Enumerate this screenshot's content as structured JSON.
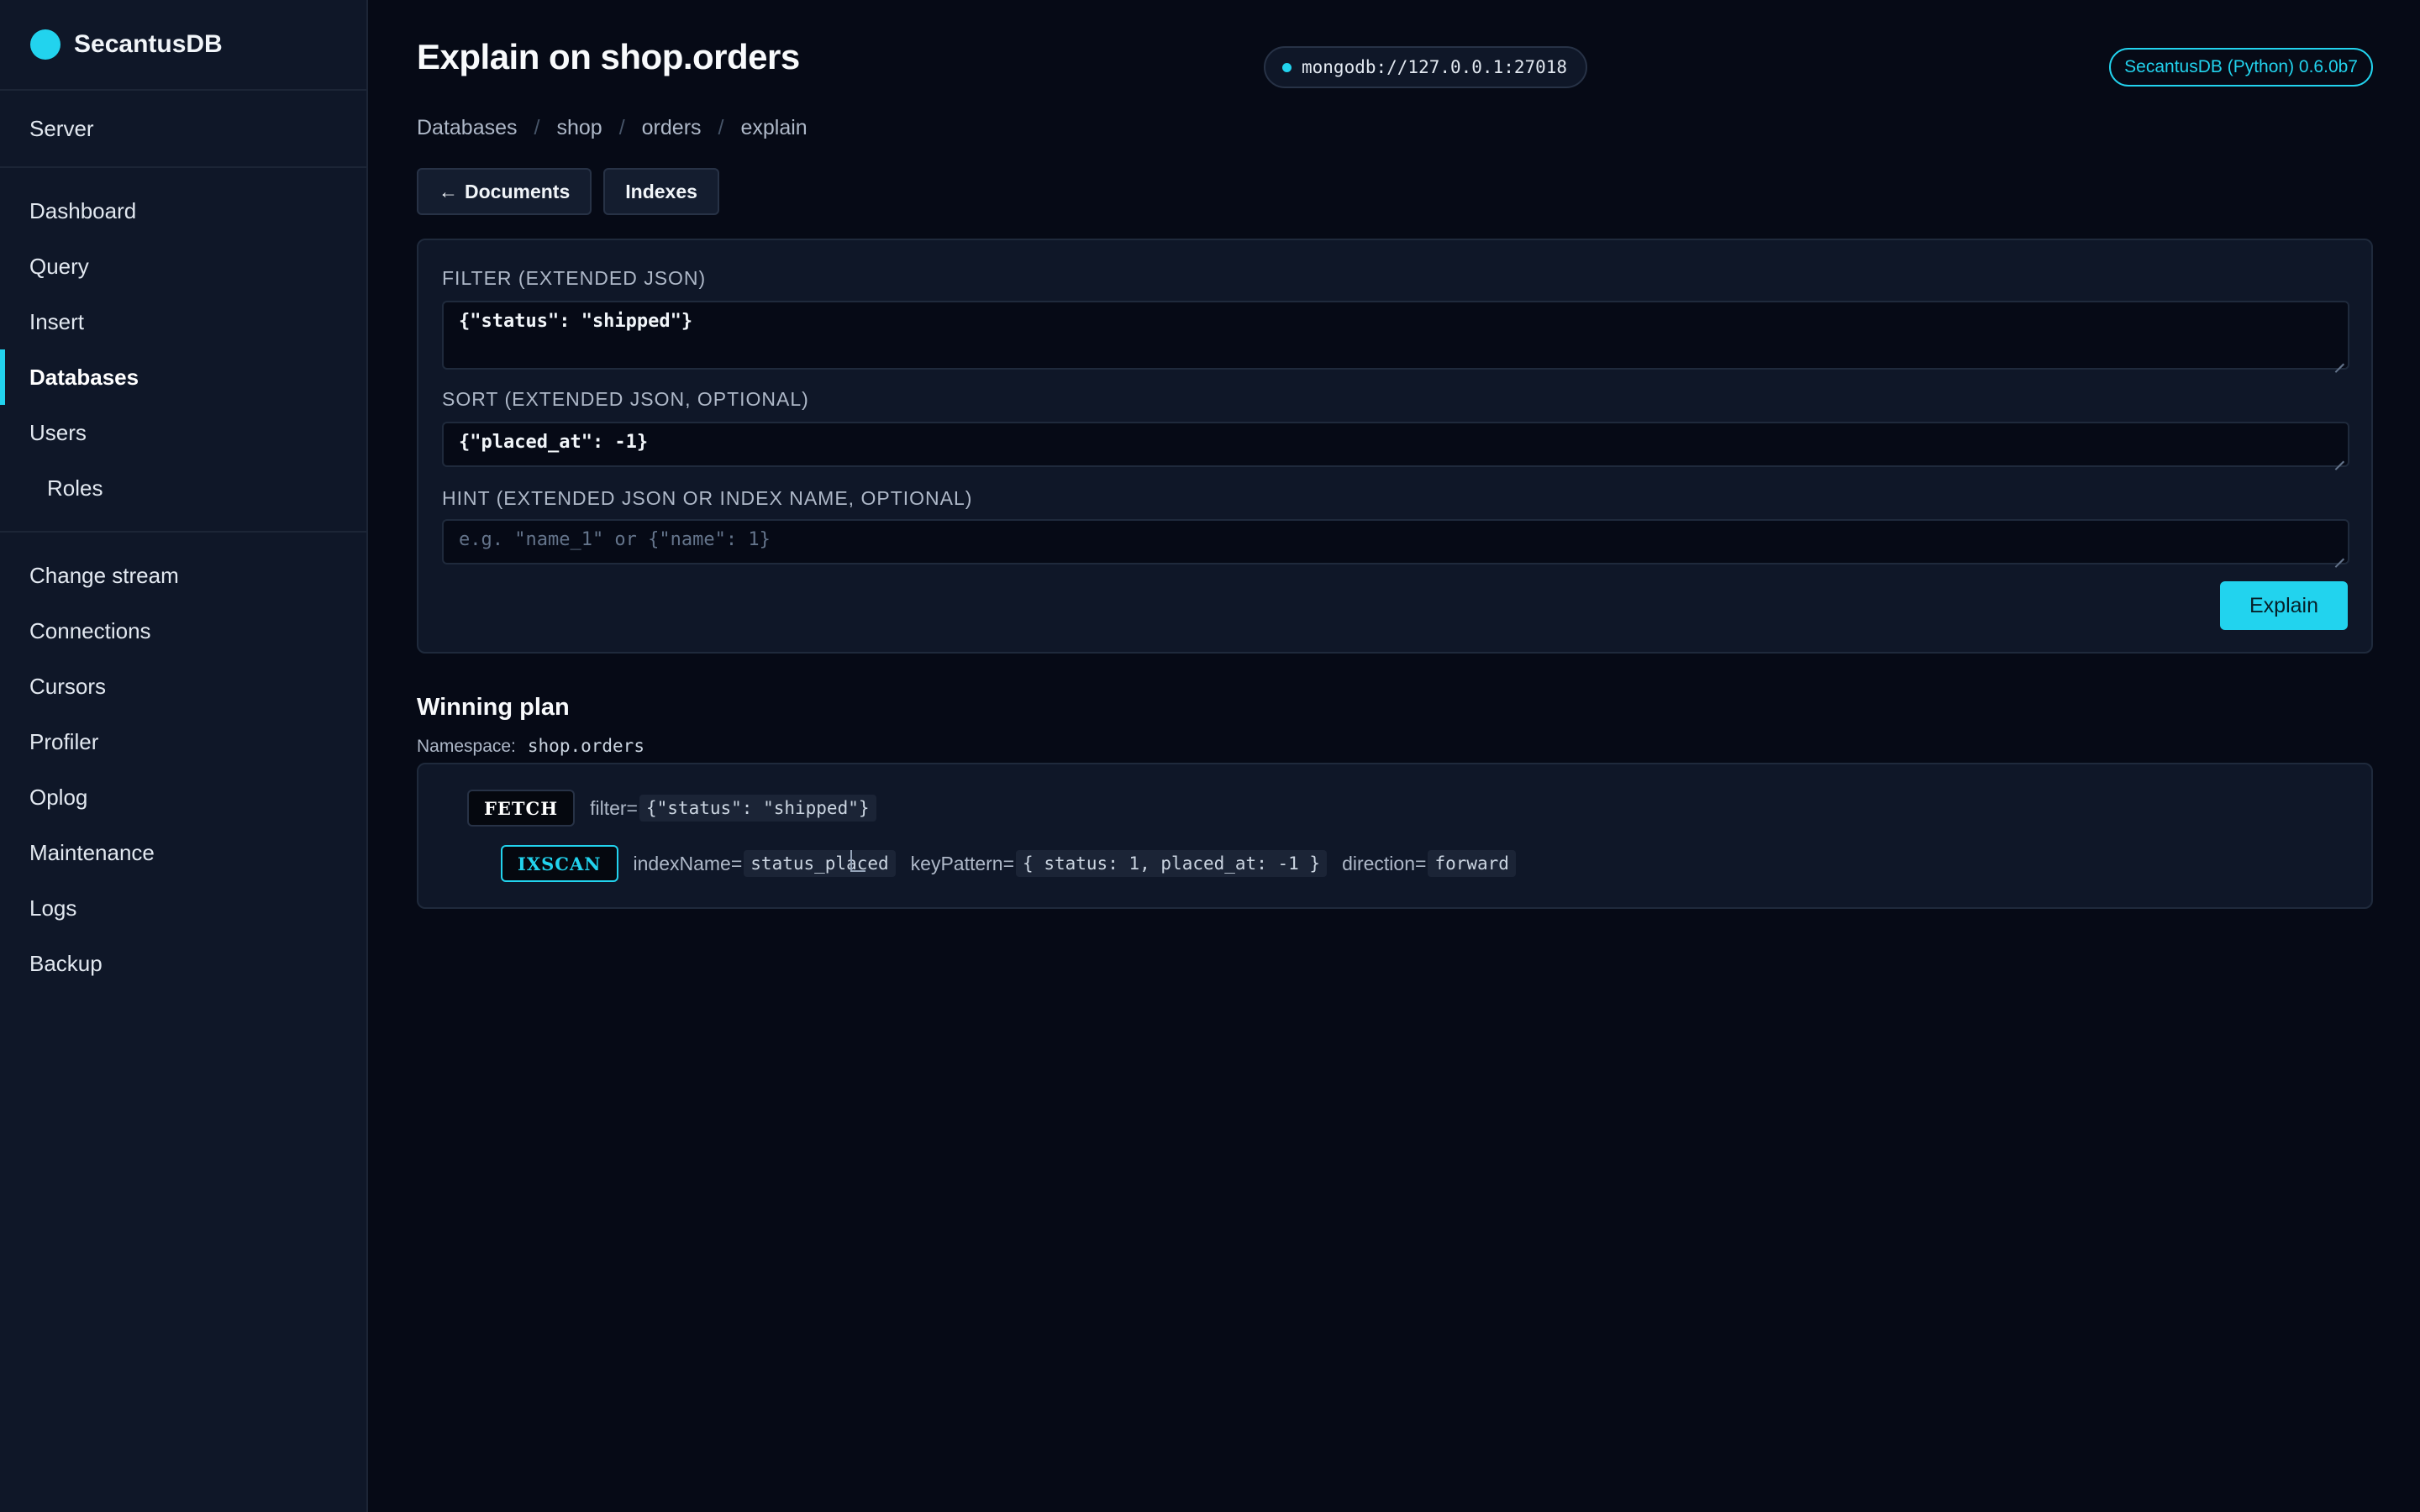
{
  "brand": {
    "name": "SecantusDB",
    "accent": "#22d3ee"
  },
  "sidebar": {
    "groups": [
      [
        {
          "label": "Server"
        }
      ],
      [
        {
          "label": "Dashboard"
        },
        {
          "label": "Query"
        },
        {
          "label": "Insert"
        },
        {
          "label": "Databases",
          "active": true
        },
        {
          "label": "Users"
        },
        {
          "label": "Roles",
          "sub": true
        }
      ],
      [
        {
          "label": "Change stream"
        },
        {
          "label": "Connections"
        },
        {
          "label": "Cursors"
        },
        {
          "label": "Profiler"
        },
        {
          "label": "Oplog"
        },
        {
          "label": "Maintenance"
        },
        {
          "label": "Logs"
        },
        {
          "label": "Backup"
        }
      ]
    ]
  },
  "header": {
    "title": "Explain on shop.orders",
    "connection": "mongodb://127.0.0.1:27018",
    "version": "SecantusDB (Python) 0.6.0b7"
  },
  "breadcrumb": [
    "Databases",
    "shop",
    "orders",
    "explain"
  ],
  "toolbar": {
    "back_icon": "←",
    "documents_label": "Documents",
    "indexes_label": "Indexes"
  },
  "form": {
    "filter_label": "FILTER (EXTENDED JSON)",
    "filter_value": "{\"status\": \"shipped\"}",
    "sort_label": "SORT (EXTENDED JSON, OPTIONAL)",
    "sort_value": "{\"placed_at\": -1}",
    "hint_label": "HINT (EXTENDED JSON OR INDEX NAME, OPTIONAL)",
    "hint_value": "",
    "hint_placeholder": "e.g. \"name_1\" or {\"name\": 1}",
    "explain_label": "Explain"
  },
  "plan": {
    "title": "Winning plan",
    "namespace_label": "Namespace:",
    "namespace": "shop.orders",
    "fetch": {
      "stage": "FETCH",
      "filter_key": "filter=",
      "filter_value": "{\"status\": \"shipped\"}"
    },
    "ixscan": {
      "stage": "IXSCAN",
      "index_key": "indexName=",
      "index_value": "status_placed",
      "pattern_key": "keyPattern=",
      "pattern_value": "{ status: 1, placed_at: -1 }",
      "direction_key": "direction=",
      "direction_value": "forward"
    }
  }
}
